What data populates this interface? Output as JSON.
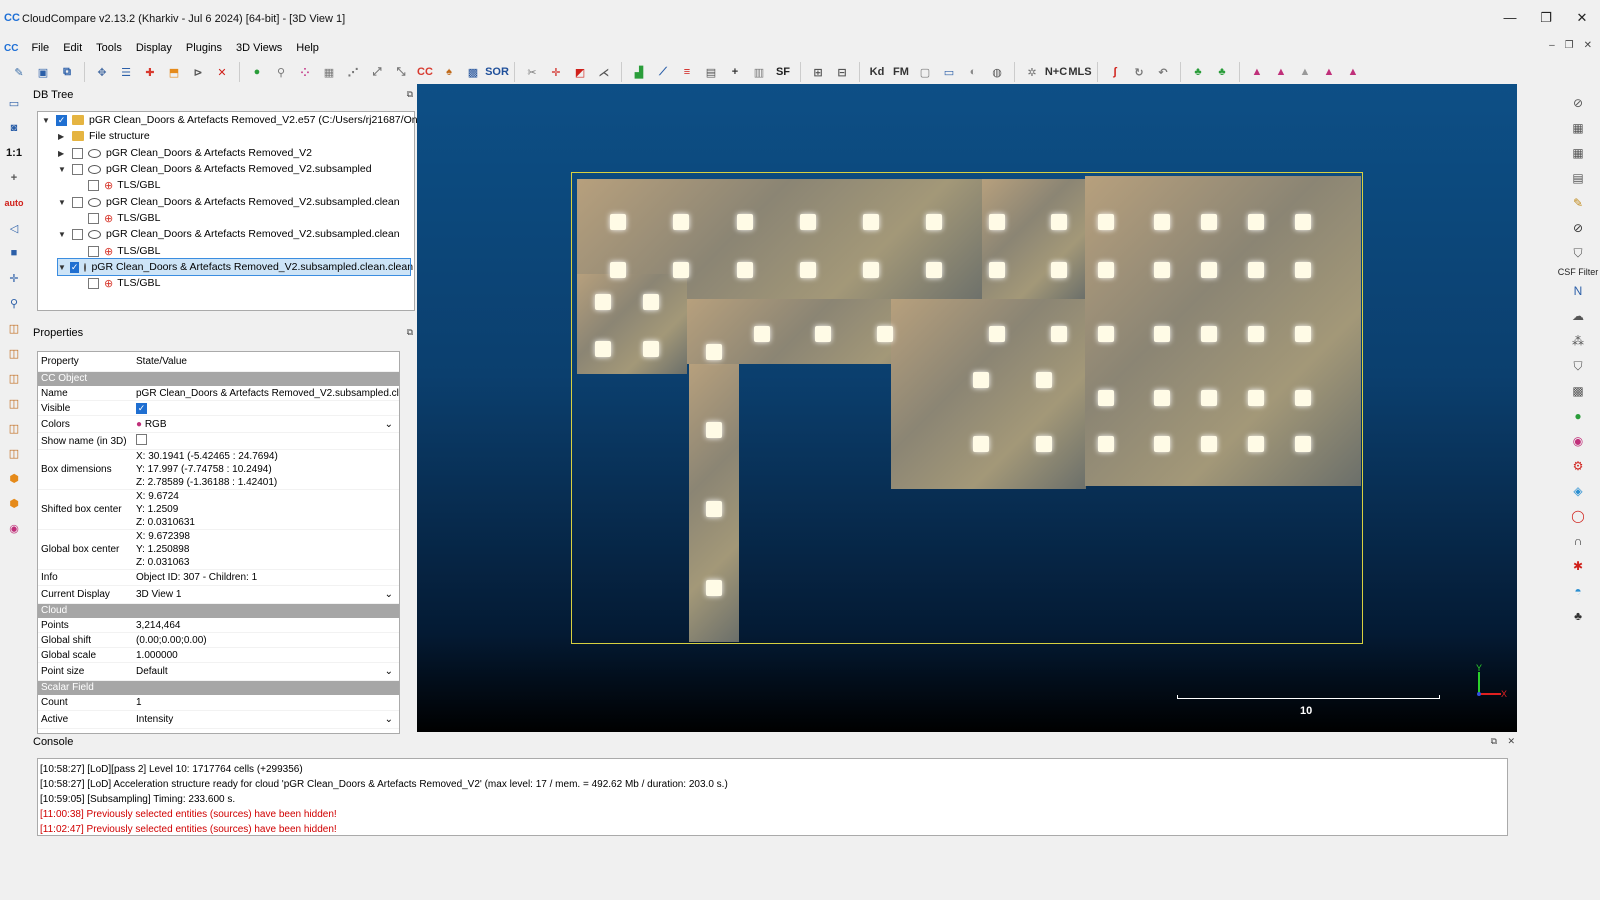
{
  "window": {
    "title": "CloudCompare v2.13.2 (Kharkiv - Jul  6 2024) [64-bit] - [3D View 1]",
    "app_icon": "CC",
    "controls": [
      "—",
      "❐",
      "✕"
    ]
  },
  "menu": [
    "File",
    "Edit",
    "Tools",
    "Display",
    "Plugins",
    "3D Views",
    "Help"
  ],
  "toolbar_labels": {
    "sor": "SOR",
    "sf": "SF",
    "kd": "Kd",
    "fm": "FM",
    "nc": "N+C",
    "mls": "MLS"
  },
  "left_tools": [
    "1:1",
    "auto"
  ],
  "right_tools": {
    "csf_label": "CSF Filter"
  },
  "dbtree": {
    "title": "DB Tree",
    "rows": [
      {
        "label": "pGR Clean_Doors & Artefacts Removed_V2.e57 (C:/Users/rj21687/One...",
        "checked": true
      },
      {
        "label": "File structure"
      },
      {
        "label": "pGR Clean_Doors & Artefacts Removed_V2",
        "checked": false
      },
      {
        "label": "pGR Clean_Doors & Artefacts Removed_V2.subsampled",
        "checked": false
      },
      {
        "label": "TLS/GBL",
        "checked": false
      },
      {
        "label": "pGR Clean_Doors & Artefacts Removed_V2.subsampled.clean",
        "checked": false
      },
      {
        "label": "TLS/GBL",
        "checked": false
      },
      {
        "label": "pGR Clean_Doors & Artefacts Removed_V2.subsampled.clean",
        "checked": false
      },
      {
        "label": "TLS/GBL",
        "checked": false
      },
      {
        "label": "pGR Clean_Doors & Artefacts Removed_V2.subsampled.clean.clean",
        "checked": true
      },
      {
        "label": "TLS/GBL",
        "checked": false
      }
    ]
  },
  "properties": {
    "title": "Properties",
    "header_property": "Property",
    "header_value": "State/Value",
    "sections": {
      "cc_object": "CC Object",
      "cloud": "Cloud",
      "scalar_field": "Scalar Field"
    },
    "name_label": "Name",
    "name_value": "pGR Clean_Doors & Artefacts Removed_V2.subsampled.cl...",
    "visible_label": "Visible",
    "colors_label": "Colors",
    "colors_value": "RGB",
    "show_name_label": "Show name (in 3D)",
    "box_dim_label": "Box dimensions",
    "box_dim_x": "X: 30.1941 (-5.42465 : 24.7694)",
    "box_dim_y": "Y: 17.997 (-7.74758 : 10.2494)",
    "box_dim_z": "Z: 2.78589 (-1.36188 : 1.42401)",
    "shifted_label": "Shifted box center",
    "shifted_x": "X: 9.6724",
    "shifted_y": "Y: 1.2509",
    "shifted_z": "Z: 0.0310631",
    "global_center_label": "Global box center",
    "global_x": "X: 9.672398",
    "global_y": "Y: 1.250898",
    "global_z": "Z: 0.031063",
    "info_label": "Info",
    "info_value": "Object ID: 307 - Children: 1",
    "display_label": "Current Display",
    "display_value": "3D View 1",
    "points_label": "Points",
    "points_value": "3,214,464",
    "shift_label": "Global shift",
    "shift_value": "(0.00;0.00;0.00)",
    "scale_label": "Global scale",
    "scale_value": "1.000000",
    "point_size_label": "Point size",
    "point_size_value": "Default",
    "count_label": "Count",
    "count_value": "1",
    "active_label": "Active",
    "active_value": "Intensity"
  },
  "view": {
    "scale_value": "10",
    "axis_x": "X",
    "axis_y": "Y"
  },
  "console": {
    "title": "Console",
    "lines": [
      {
        "text": "[10:58:27] [LoD][pass 2] Level 10: 1717764 cells (+299356)",
        "error": false
      },
      {
        "text": "[10:58:27] [LoD] Acceleration structure ready for cloud 'pGR Clean_Doors & Artefacts Removed_V2' (max level: 17 / mem. = 492.62 Mb / duration: 203.0 s.)",
        "error": false
      },
      {
        "text": "[10:59:05] [Subsampling] Timing: 233.600 s.",
        "error": false
      },
      {
        "text": "[11:00:38] Previously selected entities (sources) have been hidden!",
        "error": true
      },
      {
        "text": "[11:02:47] Previously selected entities (sources) have been hidden!",
        "error": true
      }
    ]
  }
}
